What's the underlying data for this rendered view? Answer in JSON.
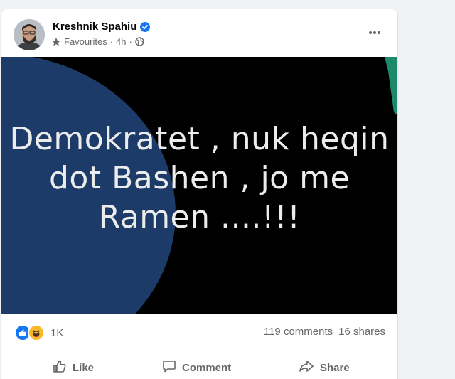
{
  "post": {
    "author": "Kreshnik Spahiu",
    "audience": "Favourites",
    "time": "4h",
    "image_text": [
      "Demokratet , nuk heqin",
      "dot Bashen , jo me",
      "Ramen ....!!!"
    ]
  },
  "stats": {
    "reaction_count": "1K",
    "comments": "119 comments",
    "shares": "16 shares"
  },
  "actions": {
    "like": "Like",
    "comment": "Comment",
    "share": "Share"
  },
  "icons": {
    "verified": "verified-badge-icon",
    "favourites": "star-icon",
    "privacy": "globe-icon",
    "more": "more-options-icon",
    "like_reaction": "like-reaction-icon",
    "haha_reaction": "haha-reaction-icon",
    "like": "thumbs-up-icon",
    "comment": "comment-icon",
    "share": "share-icon"
  },
  "colors": {
    "brand_blue": "#1877f2",
    "text_secondary": "#65676b",
    "image_blob": "#1d3b68",
    "haha_yellow": "#f7b928"
  }
}
